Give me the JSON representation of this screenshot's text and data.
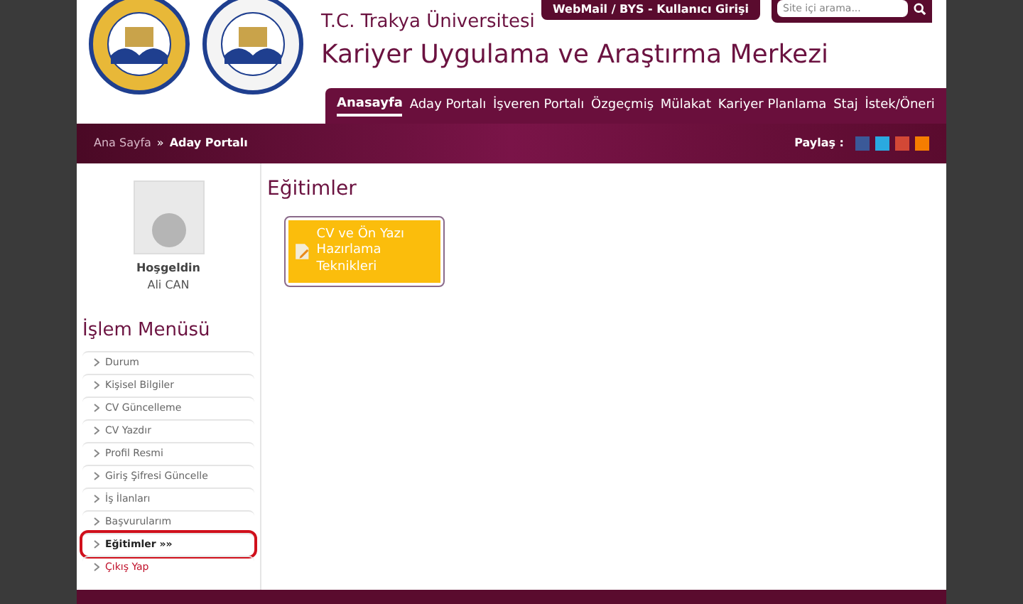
{
  "top_bar": {
    "webmail_link": "WebMail / BYS - Kullanıcı Girişi",
    "search": {
      "placeholder": "Site içi arama..."
    }
  },
  "header": {
    "subtitle": "T.C. Trakya Üniversitesi",
    "title": "Kariyer Uygulama ve Araştırma Merkezi"
  },
  "nav": [
    {
      "label": "Anasayfa",
      "selected": true
    },
    {
      "label": "Aday Portalı",
      "selected": false
    },
    {
      "label": "İşveren Portalı",
      "selected": false
    },
    {
      "label": "Özgeçmiş",
      "selected": false
    },
    {
      "label": "Mülakat",
      "selected": false
    },
    {
      "label": "Kariyer Planlama",
      "selected": false
    },
    {
      "label": "Staj",
      "selected": false
    },
    {
      "label": "İstek/Öneri",
      "selected": false
    }
  ],
  "breadcrumb": {
    "home": "Ana Sayfa",
    "separator": "»",
    "current": "Aday Portalı"
  },
  "share": {
    "label": "Paylaş :"
  },
  "profile": {
    "greeting": "Hoşgeldin",
    "name": "Ali CAN"
  },
  "menu": {
    "title": "İşlem Menüsü",
    "items": [
      {
        "label": "Durum",
        "kind": "link",
        "selected": false,
        "circled": false
      },
      {
        "label": "Kişisel Bilgiler",
        "kind": "link",
        "selected": false,
        "circled": false
      },
      {
        "label": "CV Güncelleme",
        "kind": "link",
        "selected": false,
        "circled": false
      },
      {
        "label": "CV Yazdır",
        "kind": "link",
        "selected": false,
        "circled": false
      },
      {
        "label": "Profil Resmi",
        "kind": "link",
        "selected": false,
        "circled": false
      },
      {
        "label": "Giriş Şifresi Güncelle",
        "kind": "link",
        "selected": false,
        "circled": false
      },
      {
        "label": "İş İlanları",
        "kind": "link",
        "selected": false,
        "circled": false
      },
      {
        "label": "Başvurularım",
        "kind": "link",
        "selected": false,
        "circled": false
      },
      {
        "label": "Eğitimler »»",
        "kind": "link",
        "selected": true,
        "circled": true
      },
      {
        "label": "Çıkış Yap",
        "kind": "logout",
        "selected": false,
        "circled": false
      }
    ]
  },
  "content": {
    "title": "Eğitimler",
    "cards": [
      {
        "label": "CV ve Ön Yazı Hazırlama Teknikleri"
      }
    ]
  }
}
